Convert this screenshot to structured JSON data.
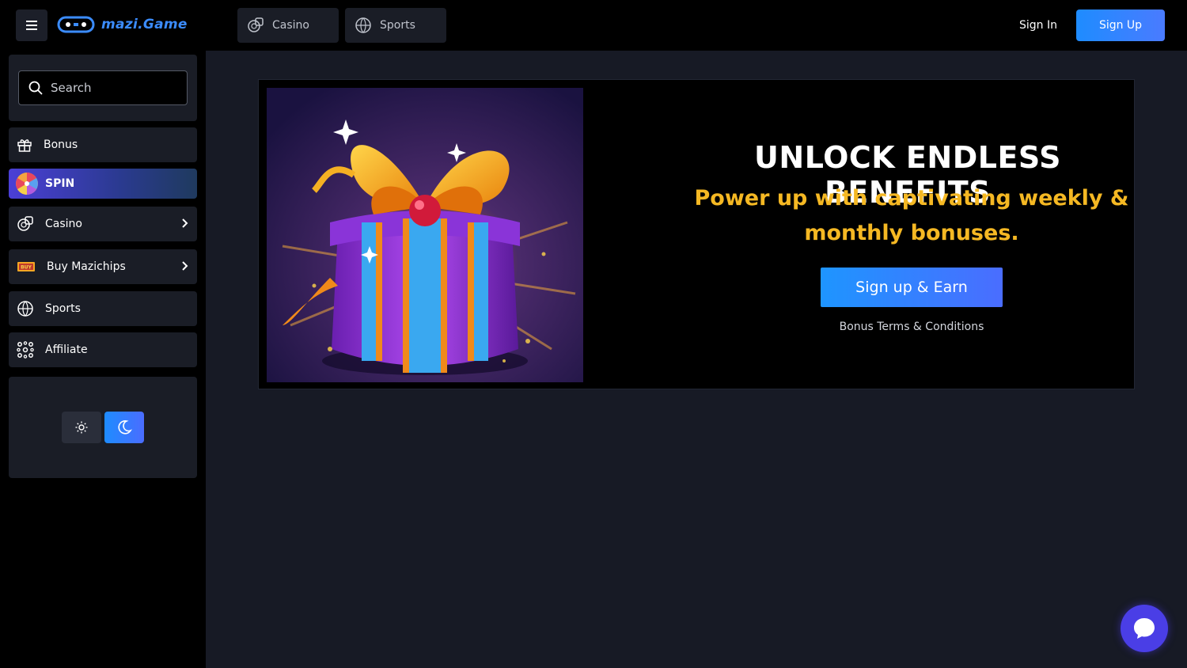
{
  "header": {
    "logo_text": "mazi.Game",
    "tabs": [
      {
        "label": "Casino",
        "icon": "casino-chips-icon"
      },
      {
        "label": "Sports",
        "icon": "basketball-icon"
      }
    ],
    "signin_label": "Sign In",
    "signup_label": "Sign Up"
  },
  "sidebar": {
    "search": {
      "placeholder": "Search"
    },
    "items": [
      {
        "label": "Bonus",
        "icon": "gift-icon"
      },
      {
        "label": "SPIN",
        "icon": "spin-wheel-icon"
      },
      {
        "label": "Casino",
        "icon": "casino-chips-icon"
      },
      {
        "label": "Buy Mazichips",
        "icon": "ticket-icon"
      },
      {
        "label": "Sports",
        "icon": "basketball-icon"
      },
      {
        "label": "Affiliate",
        "icon": "network-icon"
      }
    ],
    "theme": {
      "active": "dark"
    }
  },
  "banner": {
    "title": "UNLOCK ENDLESS BENEFITS",
    "subtitle_line1": "Power up with captivating weekly &",
    "subtitle_line2": "monthly bonuses.",
    "cta_label": "Sign up & Earn",
    "terms_label": "Bonus Terms & Conditions"
  },
  "colors": {
    "accent": "#1e8cff",
    "subtitle": "#f5b823",
    "chat_bubble": "#4a3ee6",
    "main_bg": "#171a25",
    "card_bg": "#1a1d26"
  }
}
